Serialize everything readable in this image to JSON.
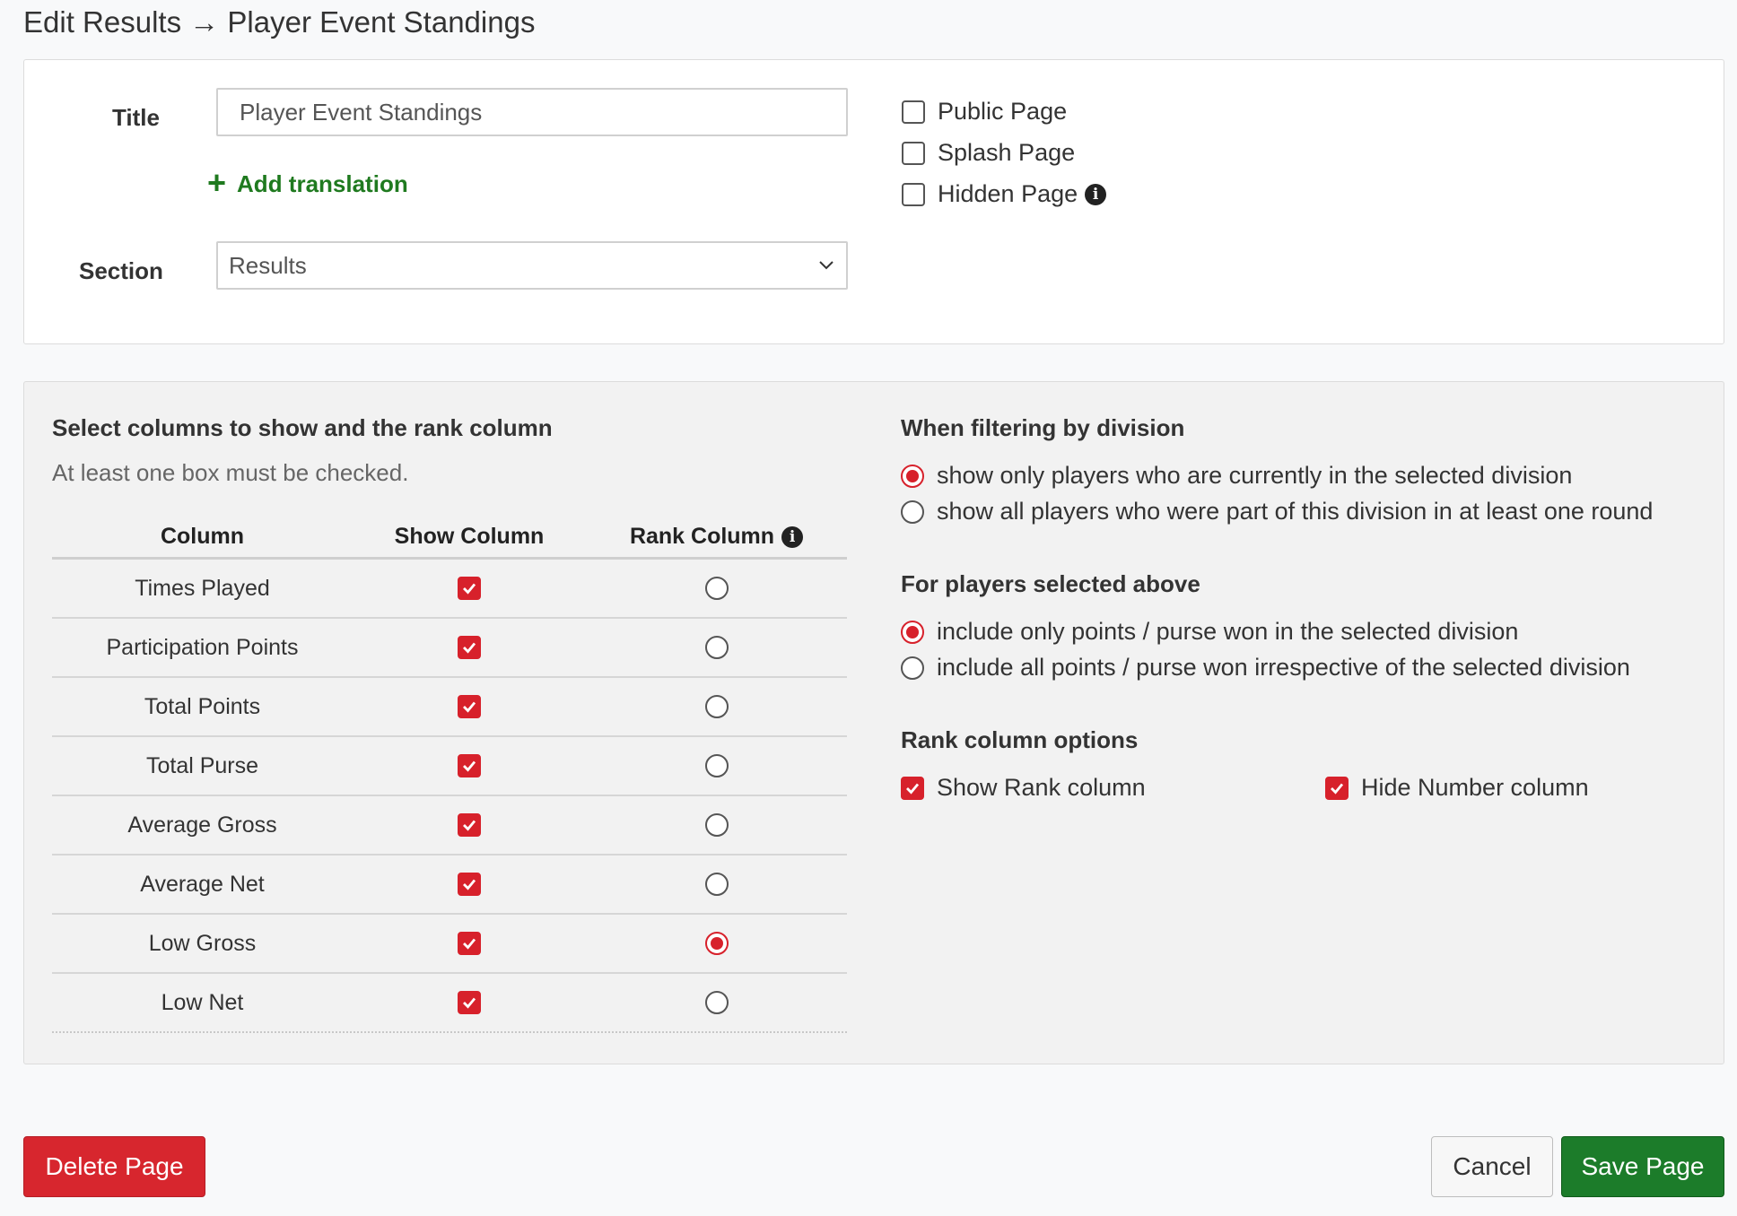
{
  "header": {
    "title": "Edit Results → Player Event Standings"
  },
  "settings": {
    "title_label": "Title",
    "title_value": "Player Event Standings",
    "add_translation": "Add translation",
    "section_label": "Section",
    "section_value": "Results",
    "public_page": "Public Page",
    "splash_page": "Splash Page",
    "hidden_page": "Hidden Page"
  },
  "columns": {
    "heading": "Select columns to show and the rank column",
    "hint": "At least one box must be checked.",
    "headers": {
      "column": "Column",
      "show": "Show Column",
      "rank": "Rank Column"
    },
    "rows": [
      {
        "name": "Times Played",
        "show": true,
        "rank": false
      },
      {
        "name": "Participation Points",
        "show": true,
        "rank": false
      },
      {
        "name": "Total Points",
        "show": true,
        "rank": false
      },
      {
        "name": "Total Purse",
        "show": true,
        "rank": false
      },
      {
        "name": "Average Gross",
        "show": true,
        "rank": false
      },
      {
        "name": "Average Net",
        "show": true,
        "rank": false
      },
      {
        "name": "Low Gross",
        "show": true,
        "rank": true
      },
      {
        "name": "Low Net",
        "show": true,
        "rank": false
      }
    ]
  },
  "division": {
    "heading": "When filtering by division",
    "opt1": "show only players who are currently in the selected division",
    "opt2": "show all players who were part of this division in at least one round"
  },
  "players": {
    "heading": "For players selected above",
    "opt1": "include only points / purse won in the selected division",
    "opt2": "include all points / purse won irrespective of the selected division"
  },
  "rank_options": {
    "heading": "Rank column options",
    "show_rank": "Show Rank column",
    "hide_number": "Hide Number column"
  },
  "actions": {
    "delete": "Delete Page",
    "cancel": "Cancel",
    "save": "Save Page"
  },
  "colors": {
    "accent_red": "#d7212b",
    "save_green": "#1c7c2a",
    "link_green": "#1f7a1f"
  }
}
